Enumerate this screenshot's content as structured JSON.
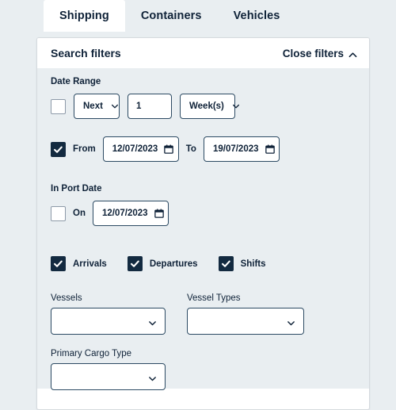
{
  "tabs": [
    {
      "label": "Shipping",
      "active": true
    },
    {
      "label": "Containers",
      "active": false
    },
    {
      "label": "Vehicles",
      "active": false
    }
  ],
  "panel": {
    "title": "Search filters",
    "close_label": "Close filters"
  },
  "date_range": {
    "section_label": "Date Range",
    "relative": {
      "checked": false,
      "direction": "Next",
      "quantity": "1",
      "unit": "Week(s)"
    },
    "absolute": {
      "checked": true,
      "from_label": "From",
      "from_value": "12/07/2023",
      "to_label": "To",
      "to_value": "19/07/2023"
    }
  },
  "in_port_date": {
    "section_label": "In Port Date",
    "checked": false,
    "on_label": "On",
    "value": "12/07/2023"
  },
  "movement_types": [
    {
      "label": "Arrivals",
      "checked": true
    },
    {
      "label": "Departures",
      "checked": true
    },
    {
      "label": "Shifts",
      "checked": true
    }
  ],
  "selectors": {
    "vessels_label": "Vessels",
    "vessels_value": "",
    "vessel_types_label": "Vessel Types",
    "vessel_types_value": "",
    "primary_cargo_label": "Primary Cargo Type",
    "primary_cargo_value": ""
  },
  "colors": {
    "page_background": "#e9eef1",
    "card_background": "#ffffff",
    "text_primary": "#0f2238",
    "control_border": "#2c4a63",
    "checkbox_checked": "#132a40",
    "checkbox_border": "#8d9aa8"
  }
}
